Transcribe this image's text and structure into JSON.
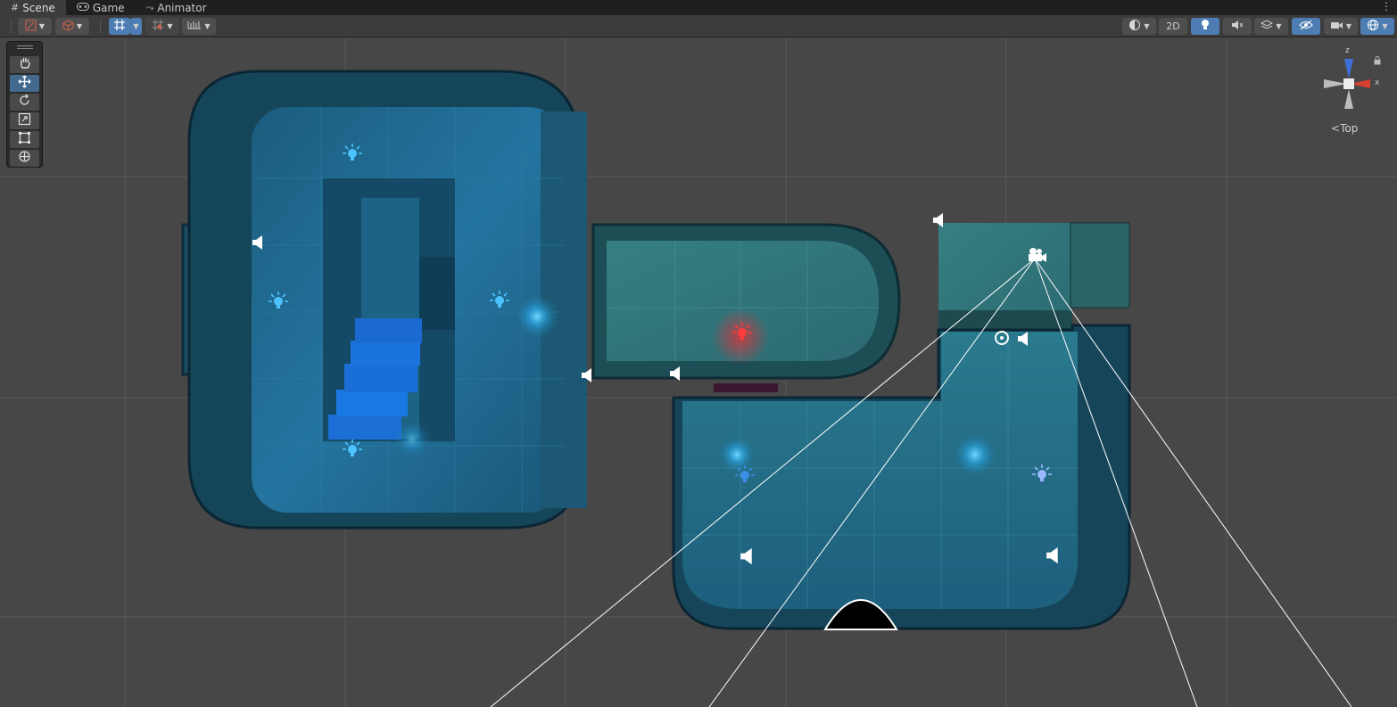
{
  "tabs": [
    {
      "label": "Scene",
      "icon": "grid-icon",
      "active": true
    },
    {
      "label": "Game",
      "icon": "gamepad-icon",
      "active": false
    },
    {
      "label": "Animator",
      "icon": "animator-icon",
      "active": false
    }
  ],
  "tab_menu_glyph": "⋮",
  "toolbar": {
    "mode_2d_label": "2D"
  },
  "tools": [
    {
      "name": "hand-tool",
      "icon": "hand-icon"
    },
    {
      "name": "move-tool",
      "icon": "move-icon",
      "active": true
    },
    {
      "name": "rotate-tool",
      "icon": "rotate-icon"
    },
    {
      "name": "scale-tool",
      "icon": "scale-icon"
    },
    {
      "name": "rect-tool",
      "icon": "rect-icon"
    },
    {
      "name": "transform-tool",
      "icon": "transform-icon"
    }
  ],
  "gizmo": {
    "view_label": "Top",
    "axis_z": "z",
    "axis_x": "x",
    "colors": {
      "z": "#3e6fd8",
      "x": "#d8412f"
    }
  },
  "colors": {
    "accent": "#4e7db3",
    "scene_bg": "#474747",
    "room_blue": "#1f6a8c",
    "room_teal": "#3d8a8a",
    "light_red": "#e0333a"
  }
}
